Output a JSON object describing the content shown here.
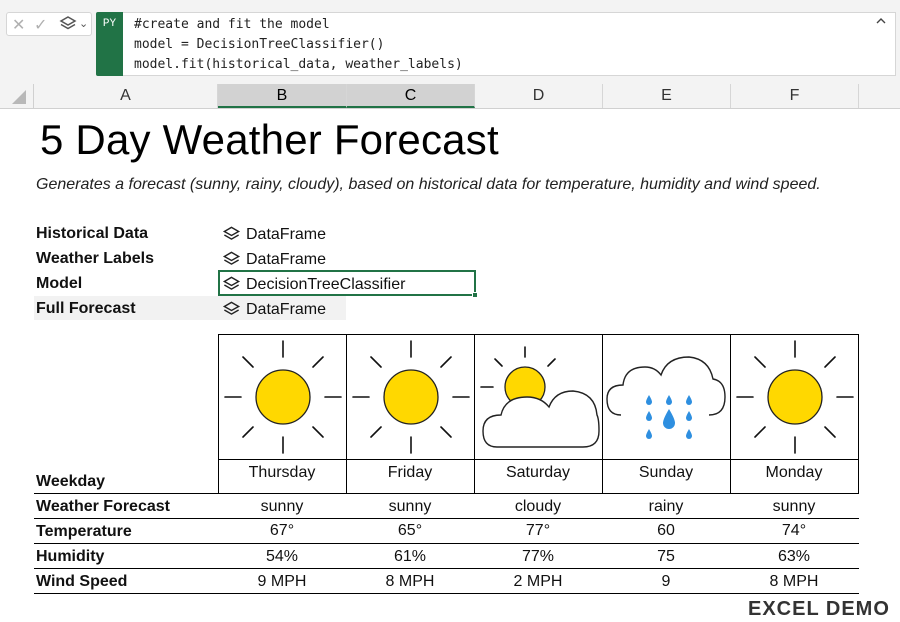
{
  "formula_bar": {
    "badge": "PY",
    "lines": [
      "#create and fit the model",
      "model = DecisionTreeClassifier()",
      "model.fit(historical_data, weather_labels)"
    ],
    "collapse_glyph": "^"
  },
  "columns": [
    "A",
    "B",
    "C",
    "D",
    "E",
    "F"
  ],
  "sheet": {
    "title": "5 Day Weather Forecast",
    "subtitle": "Generates a forecast (sunny, rainy, cloudy), based on historical data for temperature, humidity and wind speed.",
    "objects": [
      {
        "label": "Historical Data",
        "value": "DataFrame"
      },
      {
        "label": "Weather Labels",
        "value": "DataFrame"
      },
      {
        "label": "Model",
        "value": "DecisionTreeClassifier"
      },
      {
        "label": "Full Forecast",
        "value": "DataFrame"
      }
    ]
  },
  "forecast": {
    "row_labels": [
      "Weekday",
      "Weather Forecast",
      "Temperature",
      "Humidity",
      "Wind Speed"
    ],
    "days": [
      {
        "day": "Thursday",
        "icon": "sun-icon",
        "weather": "sunny",
        "temp": "67°",
        "humidity": "54%",
        "wind": "9 MPH"
      },
      {
        "day": "Friday",
        "icon": "sun-icon",
        "weather": "sunny",
        "temp": "65°",
        "humidity": "61%",
        "wind": "8 MPH"
      },
      {
        "day": "Saturday",
        "icon": "cloudy-icon",
        "weather": "cloudy",
        "temp": "77°",
        "humidity": "77%",
        "wind": "2 MPH"
      },
      {
        "day": "Sunday",
        "icon": "rain-icon",
        "weather": "rainy",
        "temp": "60",
        "humidity": "75",
        "wind": "9"
      },
      {
        "day": "Monday",
        "icon": "sun-icon",
        "weather": "sunny",
        "temp": "74°",
        "humidity": "63%",
        "wind": "8 MPH"
      }
    ]
  },
  "colors": {
    "excel_green": "#217346",
    "sun_yellow": "#FFD800"
  },
  "watermark": "EXCEL DEMO"
}
